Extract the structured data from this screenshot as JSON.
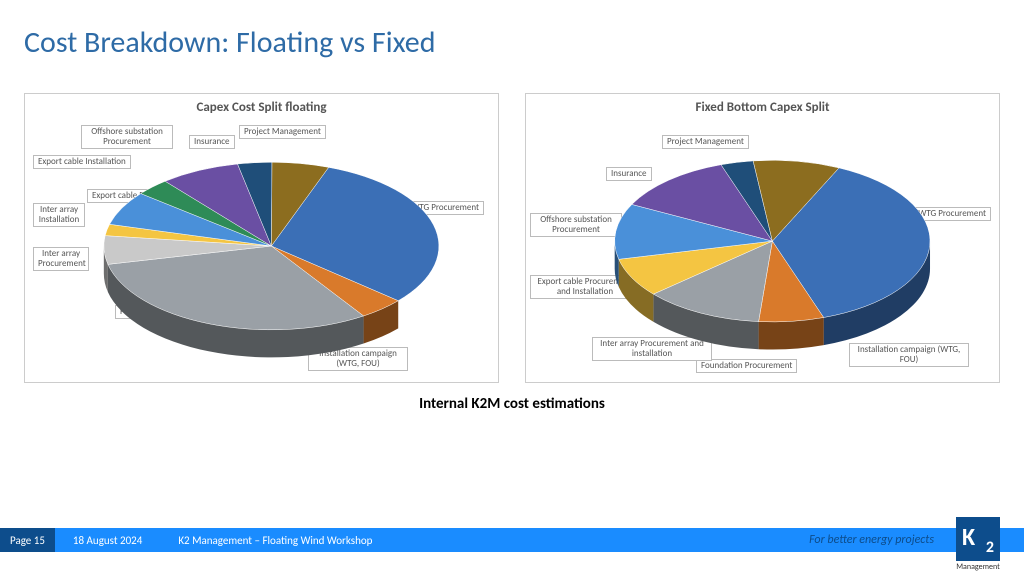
{
  "title": "Cost Breakdown: Floating vs Fixed",
  "caption": "Internal K2M cost estimations",
  "footer": {
    "page": "Page 15",
    "date": "18 August 2024",
    "title": "K2 Management – Floating Wind Workshop",
    "tagline": "For better energy projects",
    "logo_sub": "Management"
  },
  "chart_data": [
    {
      "type": "pie",
      "title": "Capex Cost Split floating",
      "series": [
        {
          "name": "WTG Procurement",
          "value": 28,
          "color": "#3b6fb6"
        },
        {
          "name": "Installation campaign (WTG, FOU)",
          "value": 4,
          "color": "#d97a2b"
        },
        {
          "name": "Foundation Procurement",
          "value": 28,
          "color": "#9aa0a6"
        },
        {
          "name": "Inter array Procurement",
          "value": 5,
          "color": "#c9c9c9"
        },
        {
          "name": "Inter array Installation",
          "value": 2,
          "color": "#f4c542"
        },
        {
          "name": "Export cable Procurement",
          "value": 6,
          "color": "#4a90d9"
        },
        {
          "name": "Export cable Installation",
          "value": 3,
          "color": "#2e8b57"
        },
        {
          "name": "Offshore substation Procurement",
          "value": 7,
          "color": "#6a4fa3"
        },
        {
          "name": "Insurance",
          "value": 3,
          "color": "#1f4e79"
        },
        {
          "name": "Project Management",
          "value": 5,
          "color": "#8c6d1f"
        }
      ]
    },
    {
      "type": "pie",
      "title": "Fixed Bottom Capex Split",
      "series": [
        {
          "name": "WTG Procurement",
          "value": 34,
          "color": "#3b6fb6"
        },
        {
          "name": "Installation campaign (WTG, FOU)",
          "value": 6,
          "color": "#d97a2b"
        },
        {
          "name": "Foundation Procurement",
          "value": 11,
          "color": "#9aa0a6"
        },
        {
          "name": "Inter array Procurement and installation",
          "value": 7,
          "color": "#f4c542"
        },
        {
          "name": "Export cable Procurement and Installation",
          "value": 10,
          "color": "#4a90d9"
        },
        {
          "name": "Offshore substation Procurement",
          "value": 11,
          "color": "#6a4fa3"
        },
        {
          "name": "Insurance",
          "value": 3,
          "color": "#1f4e79"
        },
        {
          "name": "Project Management",
          "value": 8,
          "color": "#8c6d1f"
        }
      ]
    }
  ],
  "labels_left": {
    "wtg": "WTG Procurement",
    "install": "Installation campaign\n(WTG, FOU)",
    "found": "Foundation Procurement",
    "iap": "Inter array\nProcurement",
    "iai": "Inter array\nInstallation",
    "ecp": "Export cable Procurement",
    "eci": "Export cable Installation",
    "osp": "Offshore substation\nProcurement",
    "ins": "Insurance",
    "pm": "Project Management"
  },
  "labels_right": {
    "wtg": "WTG Procurement",
    "install": "Installation campaign (WTG,\nFOU)",
    "found": "Foundation Procurement",
    "ia": "Inter array Procurement and\ninstallation",
    "ec": "Export cable Procurement\nand Installation",
    "osp": "Offshore substation\nProcurement",
    "ins": "Insurance",
    "pm": "Project Management"
  }
}
